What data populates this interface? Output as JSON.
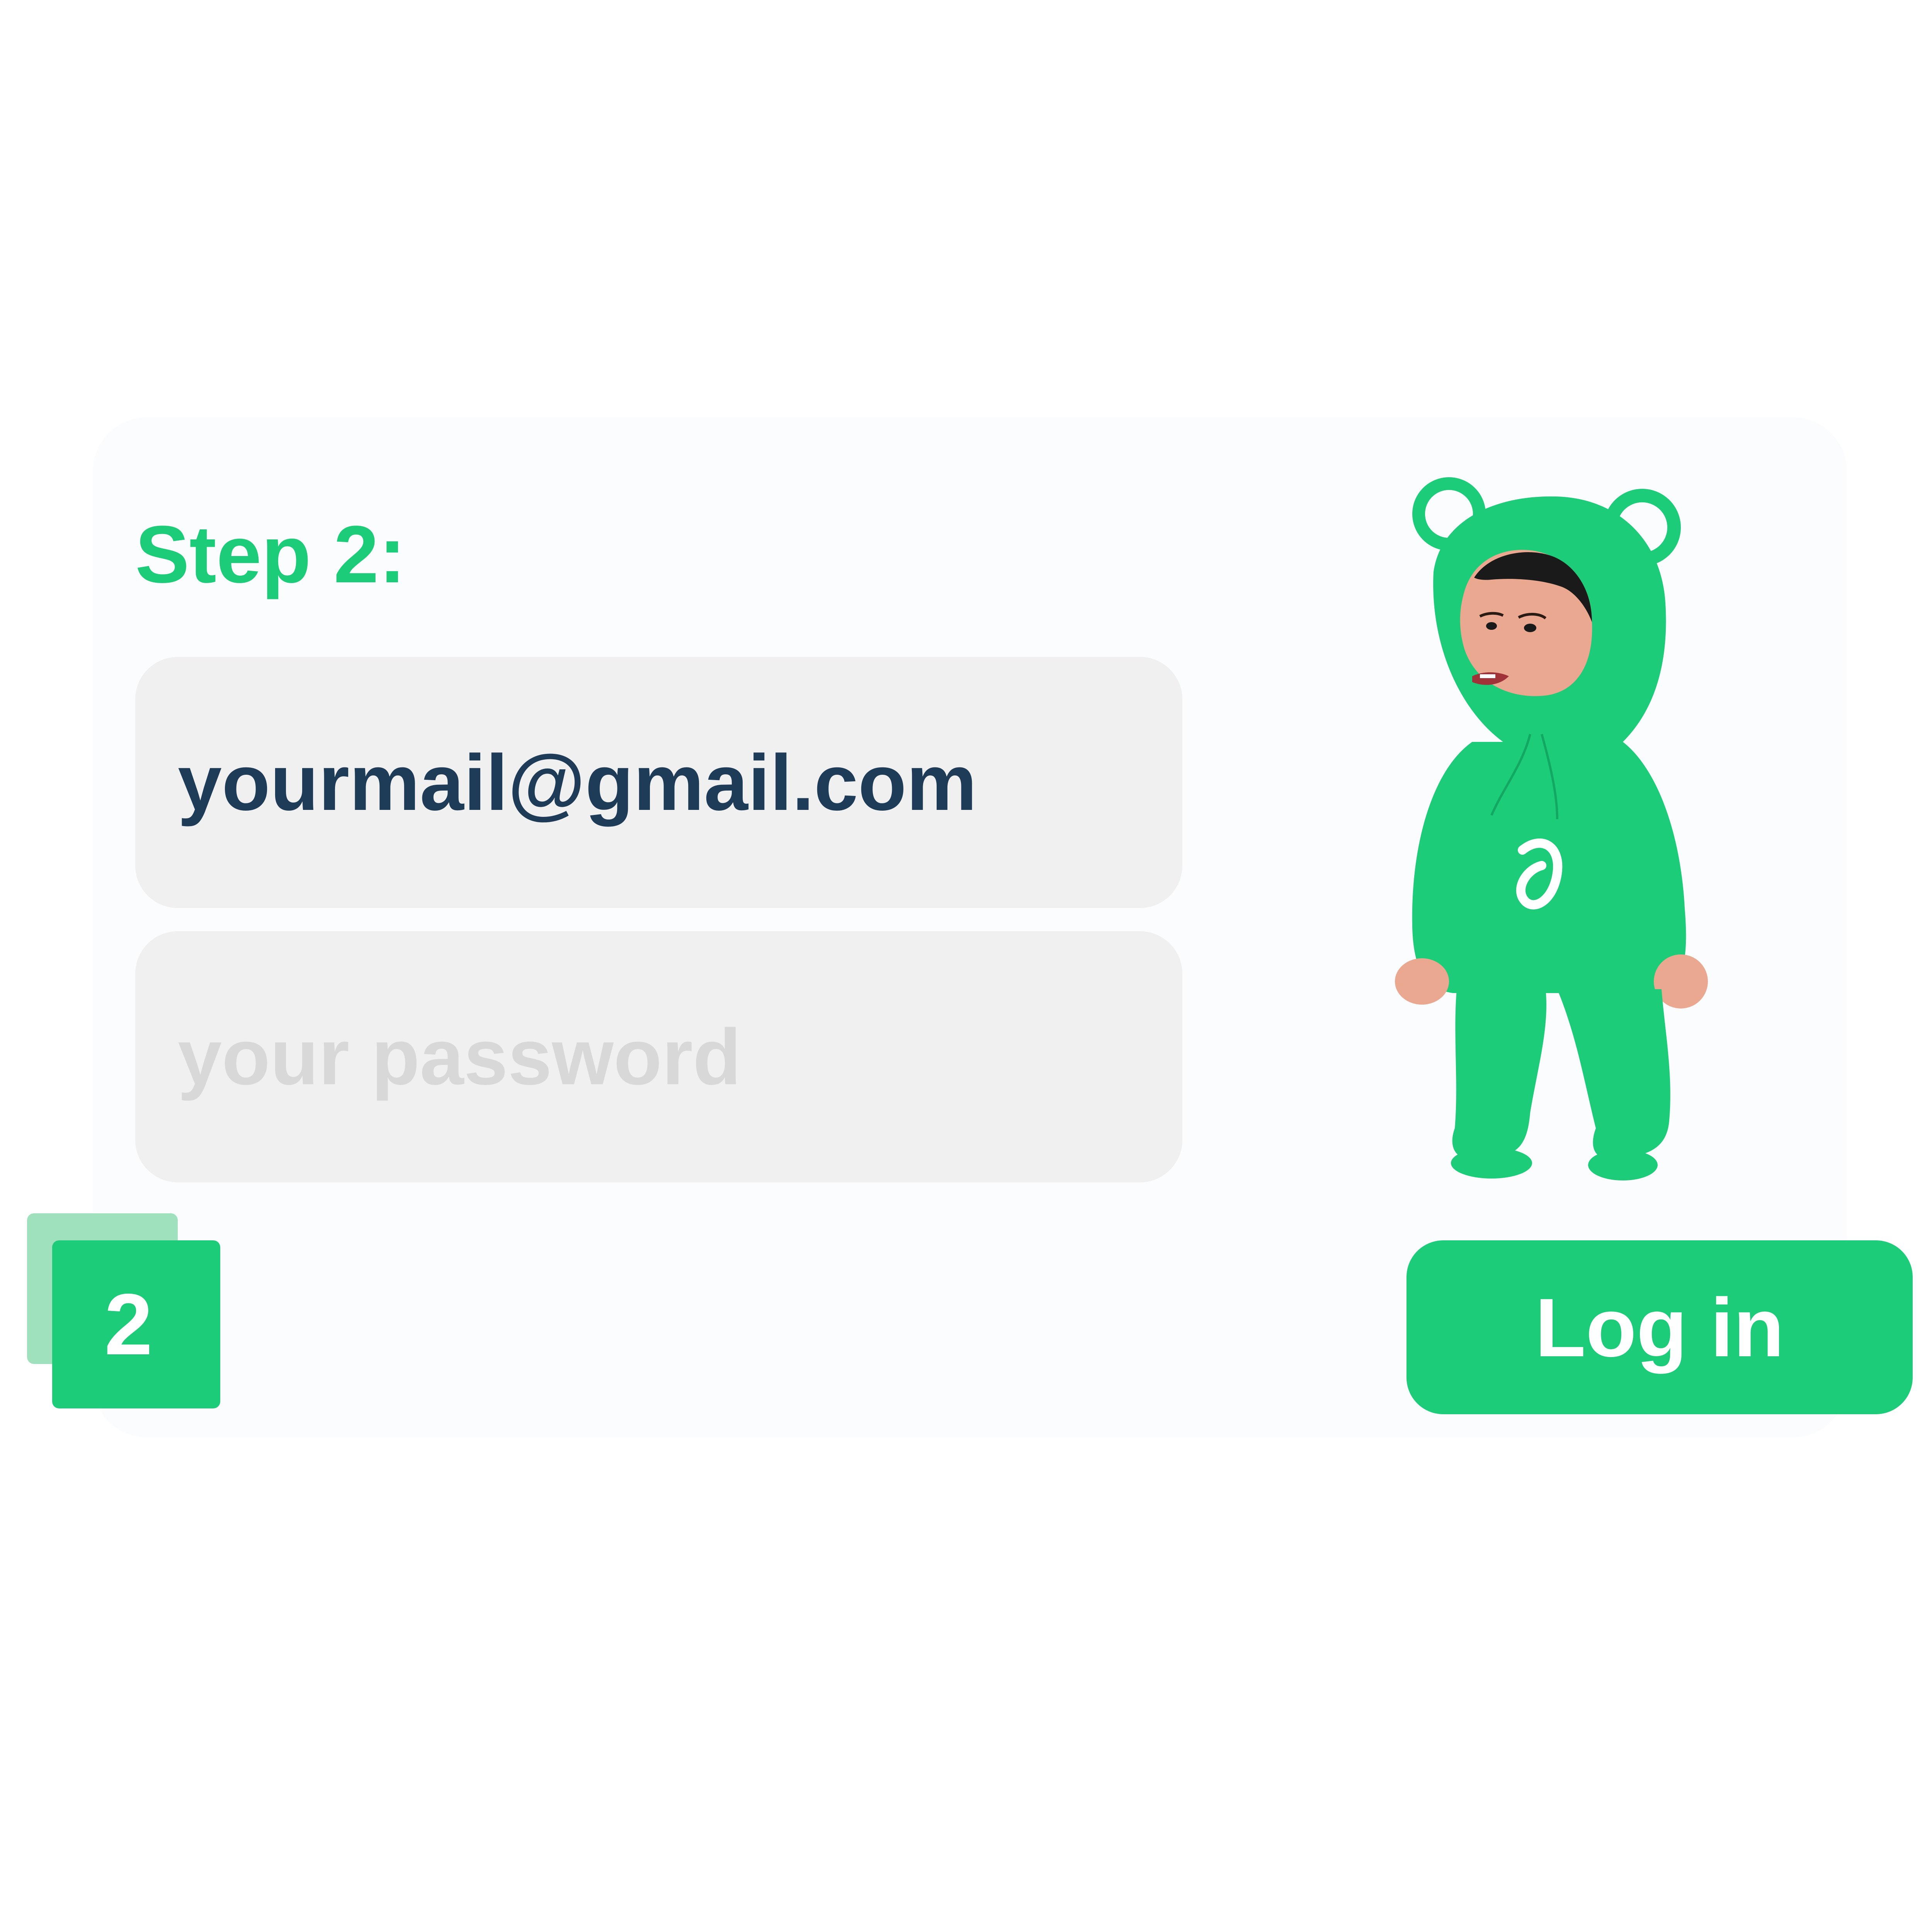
{
  "step": {
    "title": "Step 2:"
  },
  "form": {
    "email_value": "yourmail@gmail.com",
    "password_placeholder": "your password"
  },
  "badge": {
    "number": "2"
  },
  "login_button": {
    "label": "Log in"
  },
  "mascot": {
    "icon": "baby-in-green-bear-suit-illustration"
  },
  "colors": {
    "accent": "#1ccc79",
    "accent_light": "#9fe1bd",
    "field_bg": "#f0f0f0",
    "email_text": "#1e3c57",
    "placeholder_text": "#d8d8d8"
  }
}
